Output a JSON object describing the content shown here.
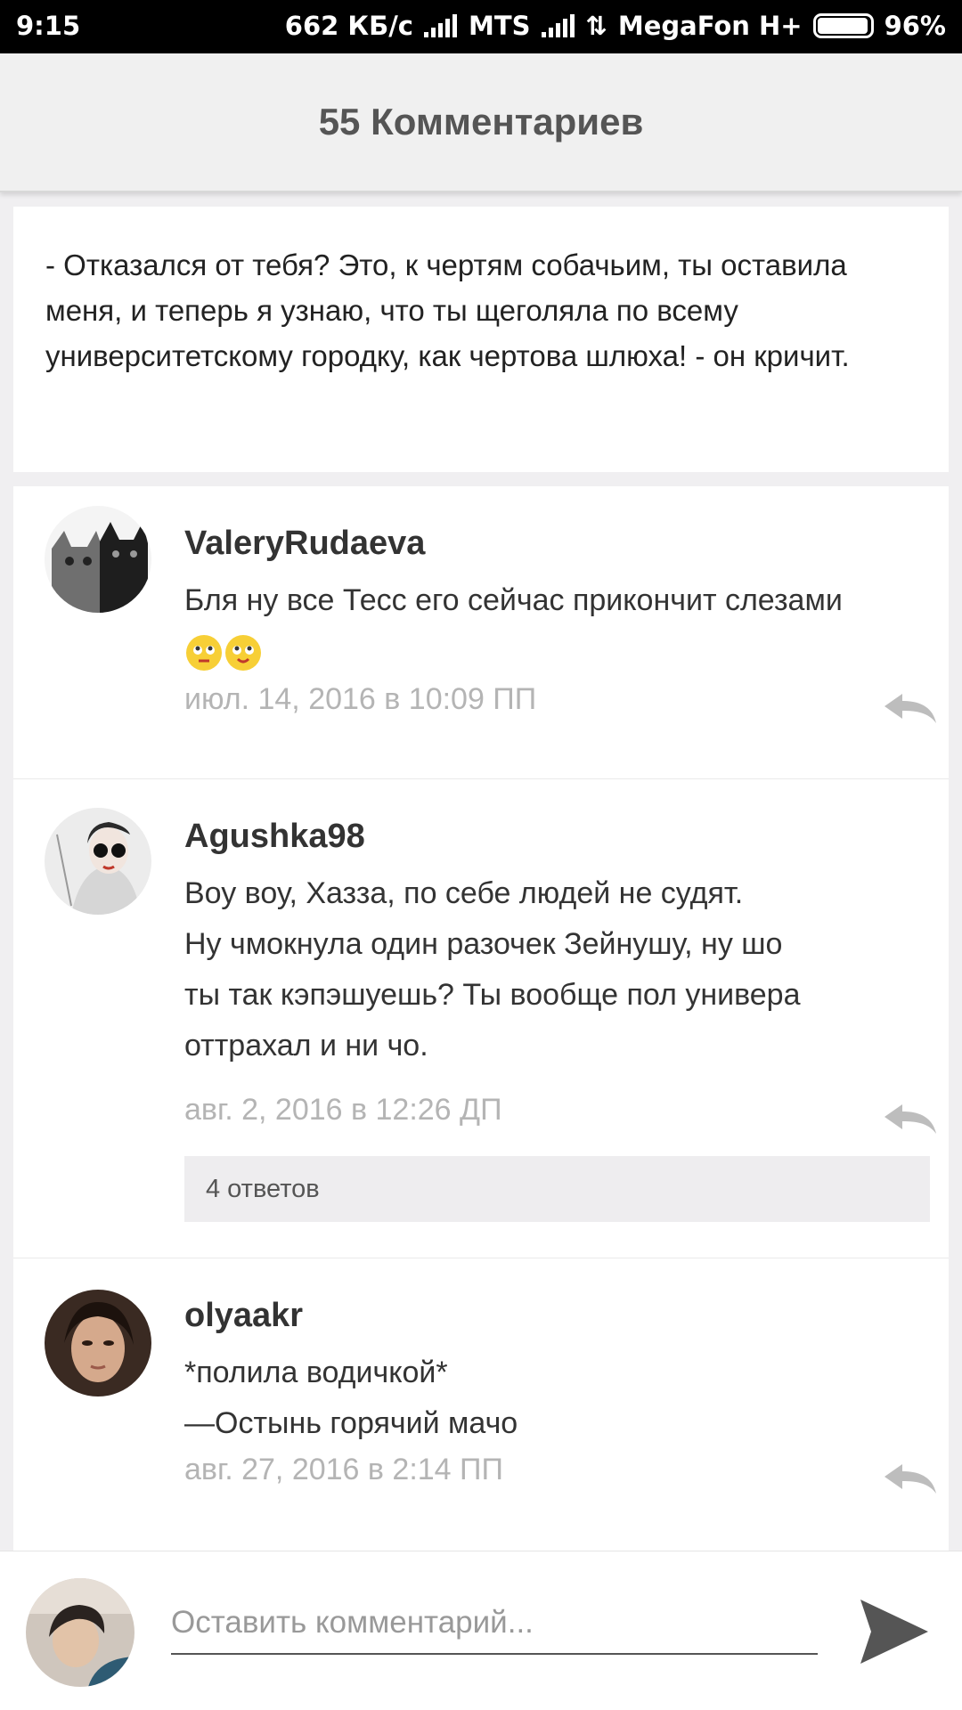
{
  "status_bar": {
    "time": "9:15",
    "speed": "662 КБ/с",
    "carrier1": "MTS",
    "carrier2": "MegaFon H+",
    "battery": "96%"
  },
  "header": {
    "title": "55 Комментариев"
  },
  "quote": {
    "text": "- Отказался от тебя? Это, к чертям собачьим, ты оставила меня, и теперь я узнаю, что ты щеголяла по всему университетскому городку, как чертова шлюха! - он кричит."
  },
  "comments": [
    {
      "author": "ValeryRudaeva",
      "lines": [
        "Бля ну все Тесс его сейчас прикончит слезами"
      ],
      "date": "июл. 14, 2016 в 10:09 ПП"
    },
    {
      "author": "Agushka98",
      "lines": [
        "Воу воу, Хазза, по себе людей не судят.",
        "Ну чмокнула один разочек Зейнушу,  ну шо",
        "ты так кэпэшуешь? Ты вообще пол универа",
        "оттрахал и ни чо."
      ],
      "date": "авг. 2, 2016 в 12:26 ДП",
      "replies": "4 ответов"
    },
    {
      "author": "olyaakr",
      "lines": [
        "*полила водичкой*",
        "—Остынь горячий мачо"
      ],
      "date": "авг. 27, 2016 в 2:14 ПП"
    }
  ],
  "input": {
    "placeholder": "Оставить комментарий..."
  },
  "colors": {
    "accent": "#555555",
    "date": "#b4b4b4",
    "reply_icon": "#bdbdbd"
  }
}
